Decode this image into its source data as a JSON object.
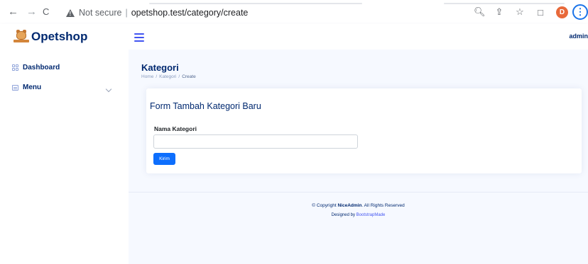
{
  "browser": {
    "back": "←",
    "forward": "→",
    "reload": "C",
    "not_secure": "Not secure",
    "separator": "|",
    "url": "opetshop.test/category/create",
    "profile_initial": "D",
    "icons": [
      "zoom-icon",
      "share-icon",
      "star-icon",
      "sidepanel-icon"
    ]
  },
  "header": {
    "brand": "Opetshop",
    "user_label": "admin"
  },
  "sidebar": {
    "items": [
      {
        "label": "Dashboard",
        "icon": "grid-icon"
      },
      {
        "label": "Menu",
        "icon": "menu-icon"
      }
    ]
  },
  "page": {
    "title": "Kategori",
    "breadcrumb": [
      "Home",
      "Kategori",
      "Create"
    ]
  },
  "form": {
    "title": "Form Tambah Kategori Baru",
    "field_label": "Nama Kategori",
    "field_value": "",
    "submit_label": "Kirim"
  },
  "footer": {
    "copyright_prefix": "© Copyright ",
    "copyright_brand": "NiceAdmin",
    "copyright_suffix": ". All Rights Reserved",
    "designed_by": "Designed by ",
    "designer": "BootstrapMade"
  },
  "colors": {
    "brand": "#012970",
    "accent": "#4154f1",
    "button": "#0d6efd",
    "background": "#f6f9ff"
  }
}
